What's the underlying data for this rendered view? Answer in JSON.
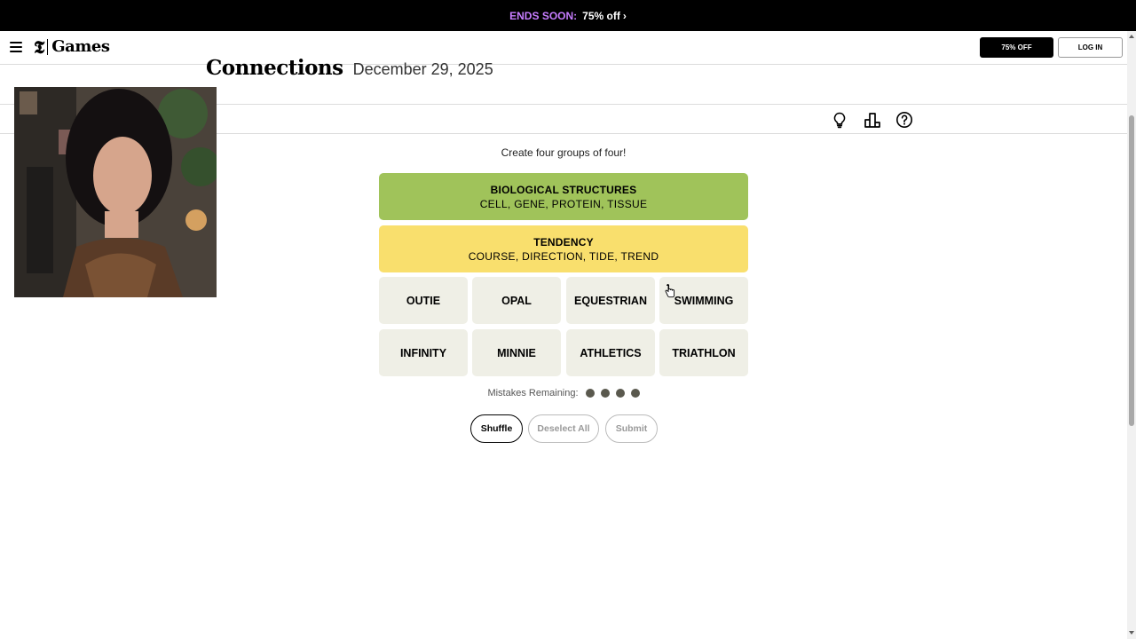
{
  "promo": {
    "label": "ENDS SOON:",
    "offer": "75% off",
    "chevron": "›"
  },
  "nav": {
    "menu_icon": "hamburger-menu-icon",
    "logo_mark": "𝕿",
    "logo_text": "Games",
    "subscribe_label": "75% OFF",
    "login_label": "LOG IN"
  },
  "game": {
    "title": "Connections",
    "date": "December 29, 2025"
  },
  "toolbar": {
    "icons": [
      "lightbulb-icon",
      "leaderboard-icon",
      "help-icon"
    ]
  },
  "board": {
    "instructions": "Create four groups of four!",
    "solved": [
      {
        "title": "BIOLOGICAL STRUCTURES",
        "words": "CELL, GENE, PROTEIN, TISSUE",
        "color": "#a0c35a"
      },
      {
        "title": "TENDENCY",
        "words": "COURSE, DIRECTION, TIDE, TREND",
        "color": "#f9df6d"
      }
    ],
    "tiles": [
      "OUTIE",
      "OPAL",
      "EQUESTRIAN",
      "SWIMMING",
      "INFINITY",
      "MINNIE",
      "ATHLETICS",
      "TRIATHLON"
    ],
    "mistakes_label": "Mistakes Remaining:",
    "mistakes_remaining": 4
  },
  "actions": {
    "shuffle": "Shuffle",
    "deselect": "Deselect All",
    "submit": "Submit"
  },
  "colors": {
    "tile_bg": "#efefe6",
    "mistake_dot": "#5a594e",
    "promo_accent": "#c77dff"
  }
}
